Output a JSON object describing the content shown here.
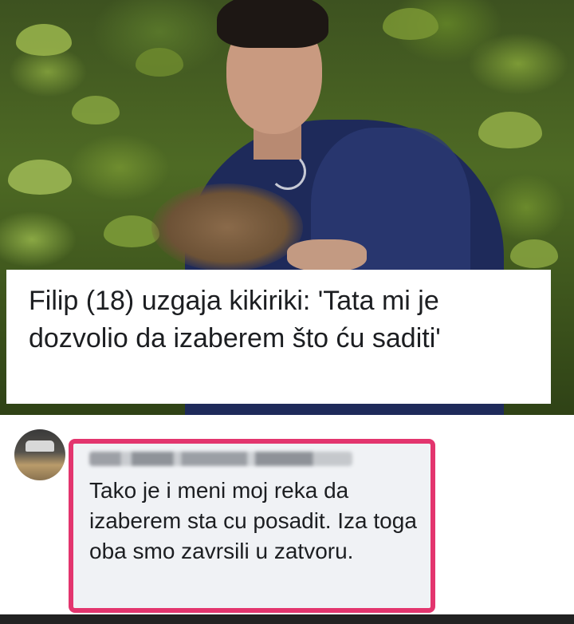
{
  "post": {
    "headline": "Filip (18) uzgaja kikiriki: 'Tata mi je dozvolio da izaberem što ću saditi'"
  },
  "comment": {
    "text": "Tako je i meni moj reka da izaberem sta cu posadit. Iza toga oba smo zavrsili u zatvoru."
  },
  "icons": {
    "loading": "loading-spinner-icon"
  },
  "colors": {
    "highlight_border": "#e3356e",
    "bubble_background": "#f0f2f5",
    "text": "#1c1e21"
  }
}
